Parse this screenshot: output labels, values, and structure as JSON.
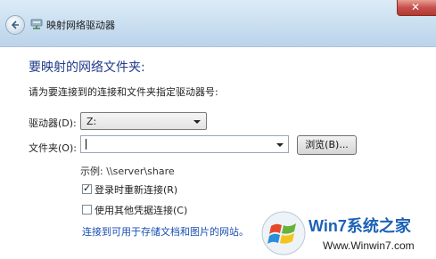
{
  "window": {
    "title": "映射网络驱动器",
    "close_symbol": "✕",
    "back_icon": "back-arrow-icon",
    "app_icon": "network-drive-icon"
  },
  "main": {
    "heading": "要映射的网络文件夹:",
    "description": "请为要连接到的连接和文件夹指定驱动器号:",
    "drive_label": "驱动器(D):",
    "drive_value": "Z:",
    "folder_label": "文件夹(O):",
    "folder_value": "",
    "browse_label": "浏览(B)...",
    "example": "示例: \\\\server\\share",
    "reconnect_label": "登录时重新连接(R)",
    "reconnect_checked": true,
    "credentials_label": "使用其他凭据连接(C)",
    "credentials_checked": false,
    "link_text": "连接到可用于存储文档和图片的网站。"
  },
  "watermark": {
    "brand": "Win7系统之家",
    "url": "Www.Winwin7.com"
  },
  "colors": {
    "heading": "#1e3a8a",
    "link": "#1a4fb4",
    "titlebar": "#c9def0",
    "close": "#c75050",
    "watermark_brand": "#1c61b5"
  }
}
